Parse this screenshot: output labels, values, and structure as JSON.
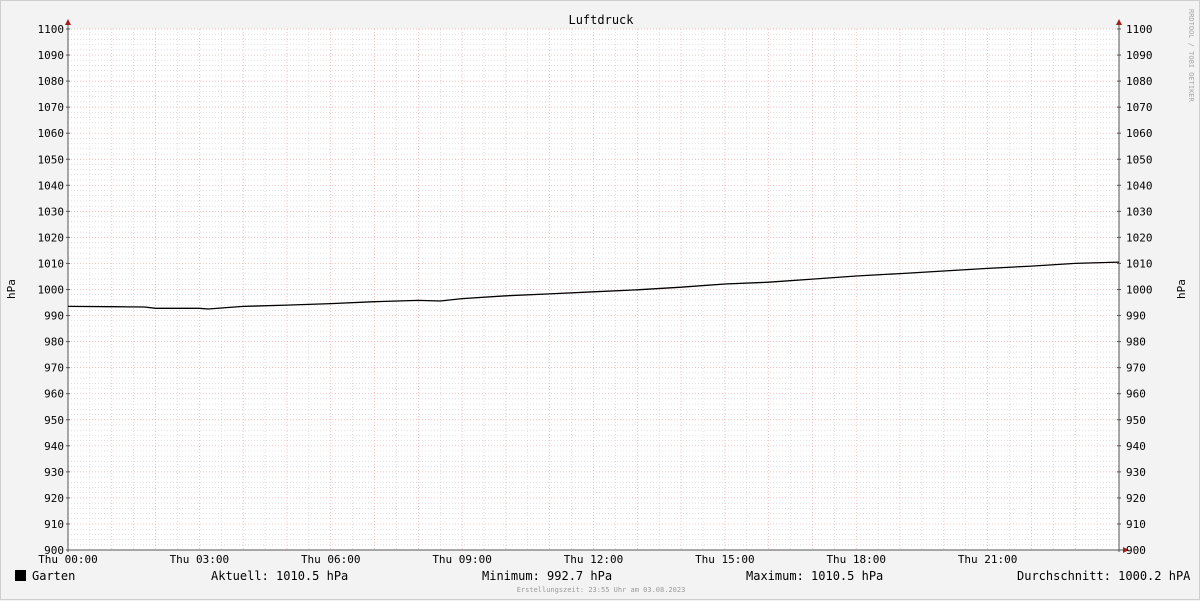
{
  "chart_data": {
    "type": "line",
    "title": "Luftdruck",
    "ylabel": "hPa",
    "ylim": [
      900,
      1100
    ],
    "yticks": [
      900,
      910,
      920,
      930,
      940,
      950,
      960,
      970,
      980,
      990,
      1000,
      1010,
      1020,
      1030,
      1040,
      1050,
      1060,
      1070,
      1080,
      1090,
      1100
    ],
    "xlim": [
      0,
      24
    ],
    "xticks": [
      {
        "x": 0,
        "label": "Thu 00:00"
      },
      {
        "x": 3,
        "label": "Thu 03:00"
      },
      {
        "x": 6,
        "label": "Thu 06:00"
      },
      {
        "x": 9,
        "label": "Thu 09:00"
      },
      {
        "x": 12,
        "label": "Thu 12:00"
      },
      {
        "x": 15,
        "label": "Thu 15:00"
      },
      {
        "x": 18,
        "label": "Thu 18:00"
      },
      {
        "x": 21,
        "label": "Thu 21:00"
      }
    ],
    "grid": true,
    "series": [
      {
        "name": "Garten",
        "color": "#000000",
        "x": [
          0,
          1,
          1.75,
          2,
          3,
          3.2,
          3.5,
          4,
          5,
          6,
          7,
          8,
          8.5,
          9,
          10,
          11,
          12,
          13,
          14,
          15,
          16,
          17,
          18,
          19,
          20,
          21,
          22,
          23,
          24
        ],
        "y": [
          993.5,
          993.4,
          993.3,
          992.8,
          992.8,
          992.5,
          992.9,
          993.5,
          994.0,
          994.6,
          995.3,
          995.8,
          995.6,
          996.5,
          997.6,
          998.3,
          999.1,
          999.9,
          1000.9,
          1002.1,
          1002.8,
          1004.0,
          1005.2,
          1006.1,
          1007.1,
          1008.1,
          1009.0,
          1010.0,
          1010.5
        ]
      }
    ]
  },
  "legend": {
    "series_name": "Garten",
    "aktuell": "Aktuell: 1010.5 hPa",
    "minimum": "Minimum: 992.7 hPa",
    "maximum": "Maximum: 1010.5 hPa",
    "durchschnitt": "Durchschnitt: 1000.2 hPA"
  },
  "footer": "Erstellungszeit: 23:55 Uhr am 03.08.2023",
  "watermark": "RRDTOOL / TOBI OETIKER",
  "colors": {
    "major_grid": "#f0a8a8",
    "minor_grid": "#cccccc",
    "line": "#000000",
    "background": "#f3f3f3",
    "plot": "#ffffff",
    "axis_arrow": "#a02020"
  }
}
